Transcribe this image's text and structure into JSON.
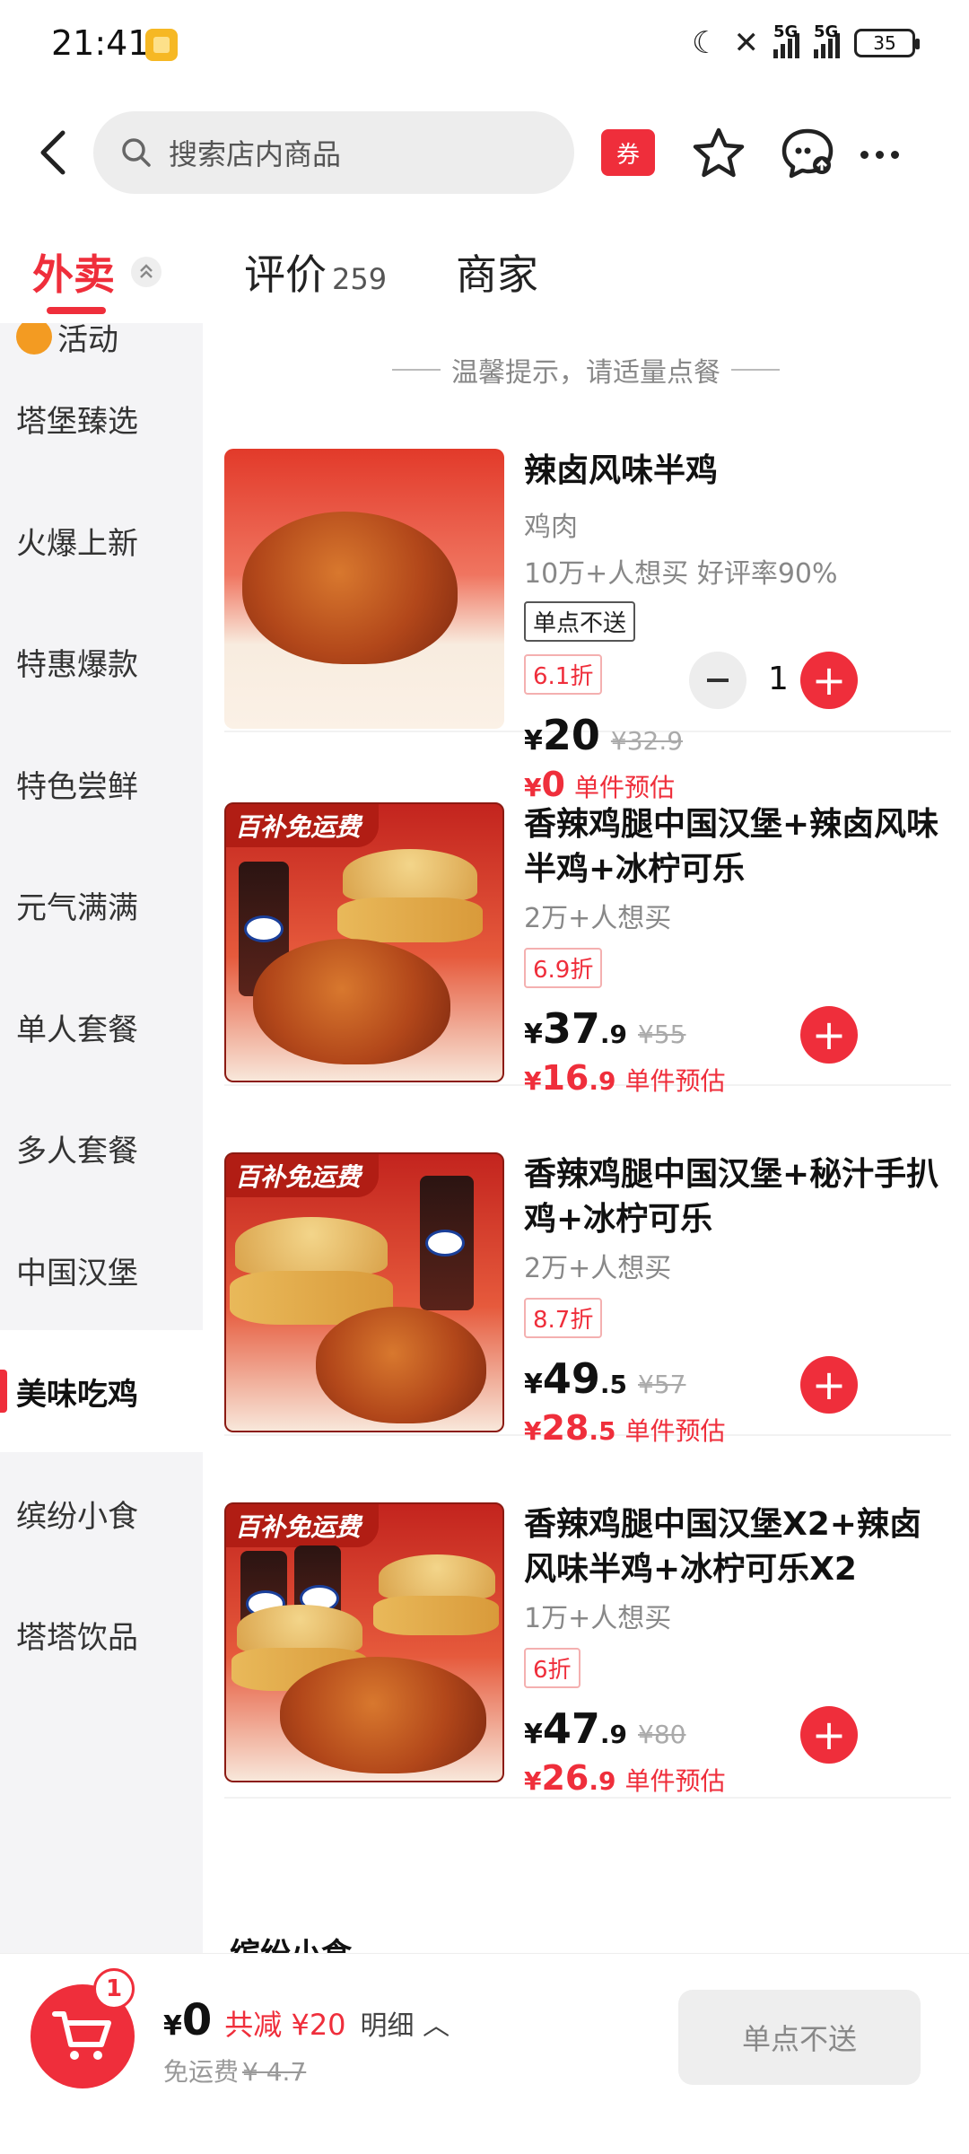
{
  "status_bar": {
    "time": "21:41",
    "battery": "35",
    "network_label": "5G"
  },
  "search": {
    "placeholder": "搜索店内商品"
  },
  "header": {
    "coupon_label": "券"
  },
  "tabs": [
    {
      "label": "外卖",
      "count": ""
    },
    {
      "label": "评价",
      "count": "259"
    },
    {
      "label": "商家",
      "count": ""
    }
  ],
  "sidebar": {
    "items": [
      {
        "label": "活动"
      },
      {
        "label": "塔堡臻选"
      },
      {
        "label": "火爆上新"
      },
      {
        "label": "特惠爆款"
      },
      {
        "label": "特色尝鲜"
      },
      {
        "label": "元气满满"
      },
      {
        "label": "单人套餐"
      },
      {
        "label": "多人套餐"
      },
      {
        "label": "中国汉堡"
      },
      {
        "label": "美味吃鸡"
      },
      {
        "label": "缤纷小食"
      },
      {
        "label": "塔塔饮品"
      }
    ],
    "active_index": 9
  },
  "content": {
    "tip": "温馨提示，请适量点餐",
    "next_section": "缤纷小食",
    "products": [
      {
        "name": "辣卤风味半鸡",
        "category": "鸡肉",
        "stats": "10万+人想买 好评率90%",
        "tag": "单点不送",
        "discount": "6.1折",
        "price_int": "20",
        "price_dec": "",
        "original": "¥32.9",
        "est_int": "0",
        "est_dec": "",
        "est_label": "单件预估",
        "quantity": "1",
        "badge": ""
      },
      {
        "name": "香辣鸡腿中国汉堡+辣卤风味半鸡+冰柠可乐",
        "stats": "2万+人想买",
        "discount": "6.9折",
        "price_int": "37",
        "price_dec": ".9",
        "original": "¥55",
        "est_int": "16",
        "est_dec": ".9",
        "est_label": "单件预估",
        "badge": "百补免运费"
      },
      {
        "name": "香辣鸡腿中国汉堡+秘汁手扒鸡+冰柠可乐",
        "stats": "2万+人想买",
        "discount": "8.7折",
        "price_int": "49",
        "price_dec": ".5",
        "original": "¥57",
        "est_int": "28",
        "est_dec": ".5",
        "est_label": "单件预估",
        "badge": "百补免运费"
      },
      {
        "name": "香辣鸡腿中国汉堡X2+辣卤风味半鸡+冰柠可乐X2",
        "stats": "1万+人想买",
        "discount": "6折",
        "price_int": "47",
        "price_dec": ".9",
        "original": "¥80",
        "est_int": "26",
        "est_dec": ".9",
        "est_label": "单件预估",
        "badge": "百补免运费"
      }
    ]
  },
  "cart": {
    "badge_count": "1",
    "currency": "¥",
    "total": "0",
    "savings": "共减 ¥20",
    "detail": "明细",
    "delivery_label": "免运费",
    "delivery_orig": "¥ 4.7",
    "action_label": "单点不送"
  },
  "colors": {
    "accent": "#ef2e3b",
    "sidebar_bg": "#f4f4f6"
  }
}
